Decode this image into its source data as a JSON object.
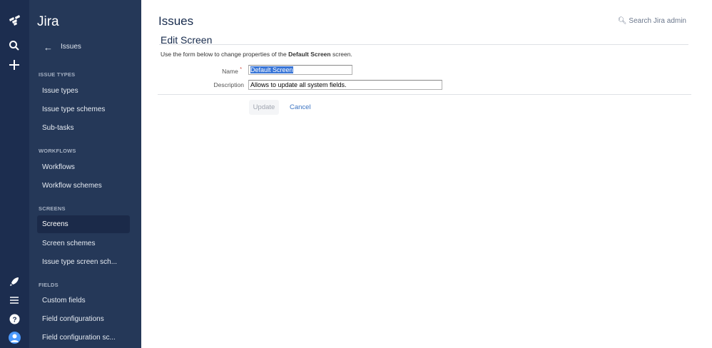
{
  "sidebar": {
    "brand": "Jira",
    "back_label": "Issues",
    "sections": [
      {
        "title": "ISSUE TYPES",
        "items": [
          "Issue types",
          "Issue type schemes",
          "Sub-tasks"
        ]
      },
      {
        "title": "WORKFLOWS",
        "items": [
          "Workflows",
          "Workflow schemes"
        ]
      },
      {
        "title": "SCREENS",
        "items": [
          "Screens",
          "Screen schemes",
          "Issue type screen sch..."
        ]
      },
      {
        "title": "FIELDS",
        "items": [
          "Custom fields",
          "Field configurations",
          "Field configuration sc..."
        ]
      }
    ],
    "selected": "Screens"
  },
  "header": {
    "title": "Issues",
    "search": "Search Jira admin"
  },
  "form": {
    "title": "Edit Screen",
    "intro_pre": "Use the form below to change properties of the ",
    "intro_bold": "Default Screen",
    "intro_post": " screen.",
    "name_label": "Name",
    "required_mark": "*",
    "name_value": "Default Screen",
    "description_label": "Description",
    "description_value": "Allows to update all system fields.",
    "update_label": "Update",
    "cancel_label": "Cancel"
  }
}
